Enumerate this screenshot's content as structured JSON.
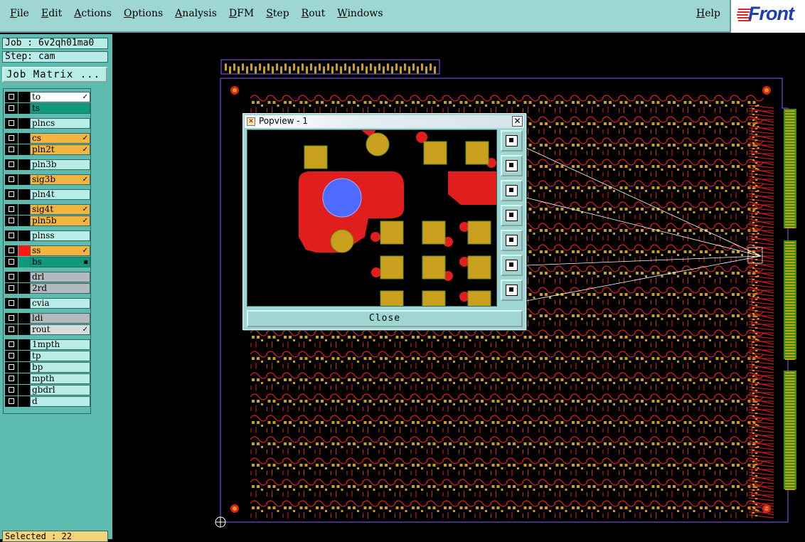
{
  "menubar": {
    "items": [
      "File",
      "Edit",
      "Actions",
      "Options",
      "Analysis",
      "DFM",
      "Step",
      "Rout",
      "Windows"
    ],
    "help": "Help",
    "logo_text": "Front"
  },
  "left_panel": {
    "job": "Job : 6v2qh01ma0",
    "step": "Step: cam",
    "job_matrix_label": "Job Matrix ...",
    "selected": "Selected : 22",
    "layers": [
      {
        "name": "to",
        "style": "white",
        "mark": "✓"
      },
      {
        "name": "ts",
        "style": "green",
        "mark": ""
      },
      {
        "name": "plncs",
        "style": "plain",
        "mark": ""
      },
      {
        "name": "cs",
        "style": "orange",
        "mark": "✓"
      },
      {
        "name": "pln2t",
        "style": "orange",
        "mark": "✓"
      },
      {
        "name": "pln3b",
        "style": "plain",
        "mark": ""
      },
      {
        "name": "sig3b",
        "style": "orange",
        "mark": "✓"
      },
      {
        "name": "pln4t",
        "style": "plain",
        "mark": ""
      },
      {
        "name": "sig4t",
        "style": "orange",
        "mark": "✓"
      },
      {
        "name": "pln5b",
        "style": "orange",
        "mark": "✓"
      },
      {
        "name": "plnss",
        "style": "plain",
        "mark": ""
      },
      {
        "name": "ss",
        "style": "orange",
        "mark": "✓",
        "color": "#ff1a1a"
      },
      {
        "name": "bs",
        "style": "green",
        "mark": "▪",
        "color": "#0f9a7a"
      },
      {
        "name": "drl",
        "style": "gray",
        "mark": ""
      },
      {
        "name": "2rd",
        "style": "gray",
        "mark": ""
      },
      {
        "name": "cvia",
        "style": "plain",
        "mark": ""
      },
      {
        "name": "ldi",
        "style": "gray",
        "mark": ""
      },
      {
        "name": "rout",
        "style": "lgray",
        "mark": "✓"
      },
      {
        "name": "1mpth",
        "style": "plain",
        "mark": ""
      },
      {
        "name": "tp",
        "style": "plain",
        "mark": ""
      },
      {
        "name": "bp",
        "style": "plain",
        "mark": ""
      },
      {
        "name": "mpth",
        "style": "plain",
        "mark": ""
      },
      {
        "name": "gbdrl",
        "style": "plain",
        "mark": ""
      },
      {
        "name": "d",
        "style": "plain",
        "mark": ""
      }
    ]
  },
  "popview": {
    "title": "Popview - 1",
    "close_label": "Close",
    "tools": [
      "zoom-fit-icon",
      "pan-up-icon",
      "pan-down-icon",
      "pan-left-icon",
      "pan-right-icon",
      "zoom-in-icon",
      "zoom-out-icon"
    ]
  },
  "colors": {
    "menubar": "#9dd6d2",
    "panel": "#5dbbb0",
    "copper": "#c8a01e",
    "trace": "#e11e1e",
    "pad_blue": "#4d6bff",
    "outline": "#8a5cff"
  }
}
